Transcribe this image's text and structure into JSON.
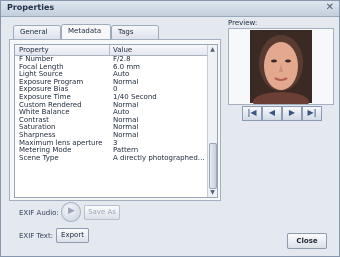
{
  "window": {
    "title": "Properties"
  },
  "tabs": [
    {
      "label": "General"
    },
    {
      "label": "Metadata"
    },
    {
      "label": "Tags"
    }
  ],
  "metadata_table": {
    "columns": [
      "Property",
      "Value"
    ],
    "rows": [
      {
        "property": "F Number",
        "value": "F/2.8"
      },
      {
        "property": "Focal Length",
        "value": "6.0 mm"
      },
      {
        "property": "Light Source",
        "value": "Auto"
      },
      {
        "property": "Exposure Program",
        "value": "Normal"
      },
      {
        "property": "Exposure Bias",
        "value": "0"
      },
      {
        "property": "Exposure Time",
        "value": "1/40 Second"
      },
      {
        "property": "Custom Rendered",
        "value": "Normal"
      },
      {
        "property": "White Balance",
        "value": "Auto"
      },
      {
        "property": "Contrast",
        "value": "Normal"
      },
      {
        "property": "Saturation",
        "value": "Normal"
      },
      {
        "property": "Sharpness",
        "value": "Normal"
      },
      {
        "property": "Maximum lens aperture",
        "value": "3"
      },
      {
        "property": "Metering Mode",
        "value": "Pattern"
      },
      {
        "property": "Scene Type",
        "value": "A directly photographed i..."
      }
    ]
  },
  "exif_audio": {
    "label": "EXIF Audio:",
    "save_label": "Save As"
  },
  "exif_text": {
    "label": "EXIF Text:",
    "export_label": "Export"
  },
  "preview": {
    "label": "Preview:"
  },
  "nav": {
    "first_icon": "skip-first-icon",
    "prev_icon": "arrow-left-icon",
    "next_icon": "arrow-right-icon",
    "last_icon": "skip-last-icon"
  },
  "footer": {
    "close_label": "Close"
  }
}
